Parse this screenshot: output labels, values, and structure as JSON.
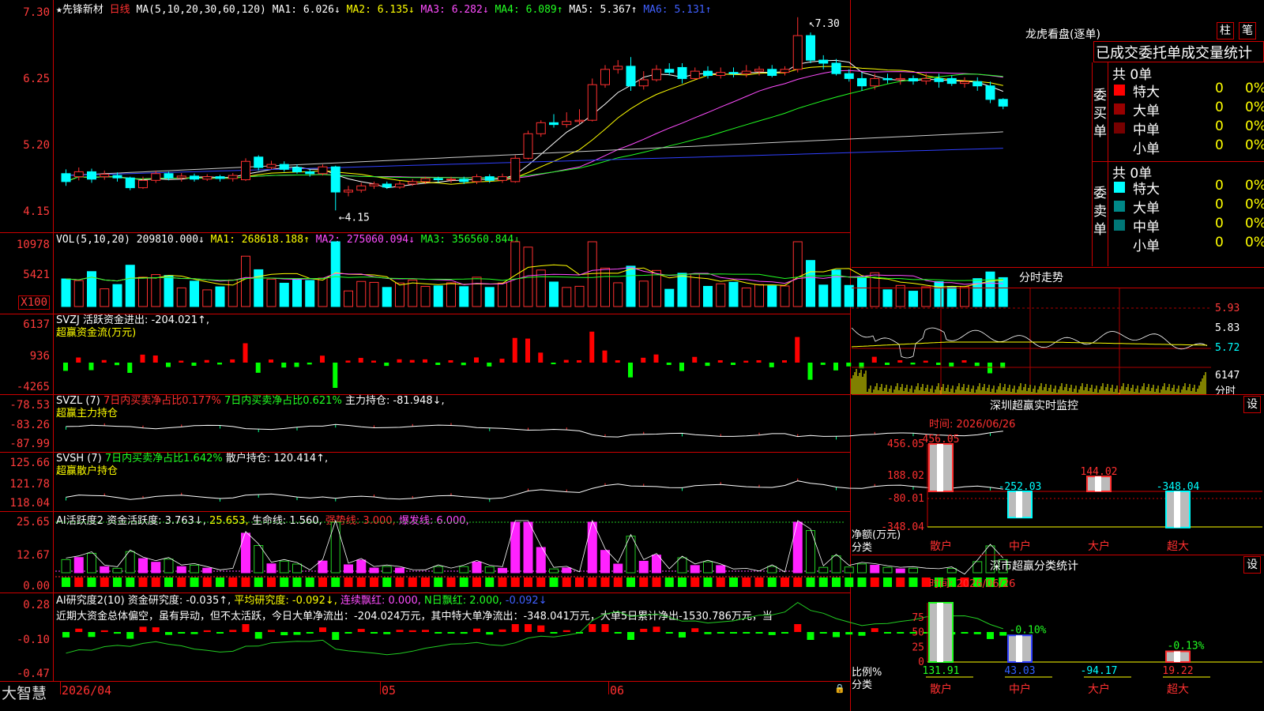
{
  "header": {
    "star": "★",
    "stock_name": "先锋新材",
    "period": "日线",
    "ma_params": "MA(5,10,20,30,60,120)",
    "ma_values": [
      {
        "label": "MA1:",
        "value": "6.026↓",
        "color": "#ffffff"
      },
      {
        "label": "MA2:",
        "value": "6.135↓",
        "color": "#ffff00"
      },
      {
        "label": "MA3:",
        "value": "6.282↓",
        "color": "#ff4dff"
      },
      {
        "label": "MA4:",
        "value": "6.089↑",
        "color": "#22ff22"
      },
      {
        "label": "MA5:",
        "value": "5.367↑",
        "color": "#ffffff"
      },
      {
        "label": "MA6:",
        "value": "5.131↑",
        "color": "#4060ff"
      }
    ]
  },
  "price_axis": [
    "7.30",
    "6.25",
    "5.20",
    "4.15"
  ],
  "price_annotations": {
    "high": "7.30",
    "low": "4.15"
  },
  "vol": {
    "axis": [
      "10978",
      "5421",
      "X100"
    ],
    "header": {
      "name": "VOL(5,10,20)",
      "value": "209810.000↓",
      "ma1": "MA1: 268618.188↑",
      "ma2": "MA2: 275060.094↓",
      "ma3": "MA3: 356560.844↓"
    }
  },
  "svzj": {
    "axis": [
      "6137",
      "936",
      "-4265"
    ],
    "line1": "SVZJ  活跃资金进出: -204.021↑,",
    "line2": "超赢资金流(万元)"
  },
  "svzl": {
    "axis": [
      "-78.53",
      "-83.26",
      "-87.99"
    ],
    "name": "SVZL (7)",
    "item1": "7日内买卖净占比0.177%",
    "item2": "7日内买卖净占比0.621%",
    "item3": "主力持仓: -81.948↓,",
    "line2": "超赢主力持仓"
  },
  "svsh": {
    "axis": [
      "125.66",
      "121.78",
      "118.04"
    ],
    "name": "SVSH (7)",
    "item1": "7日内买卖净占比1.642%",
    "item2": "散户持仓: 120.414↑,",
    "line2": "超赢散户持仓"
  },
  "ai1": {
    "axis": [
      "25.65",
      "12.67",
      "0.00"
    ],
    "name": "AI活跃度2",
    "item1": "资金活跃度: 3.763↓,",
    "item2": "25.653,",
    "item3": "生命线: 1.560,",
    "item4": "强势线: 3.000,",
    "item5": "爆发线: 6.000,"
  },
  "ai2": {
    "axis": [
      "0.28",
      "-0.10",
      "-0.47"
    ],
    "name": "AI研究度2(10)",
    "item1": "资金研究度: -0.035↑,",
    "item2": "平均研究度: -0.092↓,",
    "item3": "连续飘红: 0.000,",
    "item4": "N日飘红: 2.000,",
    "item5": "-0.092↓",
    "comment": "近期大资金总体偏空，虽有异动，但不太活跃，今日大单净流出：-204.024万元，其中特大单净流出：-348.041万元，大单5日累计净出-1530.786万元，当"
  },
  "footer": {
    "brand": "大智慧",
    "dates": [
      "2026/04",
      "05",
      "06"
    ]
  },
  "dragon": {
    "title": "龙虎看盘(逐单)",
    "btn1": "柱",
    "btn2": "笔",
    "tabs": "已成交委托单成交量统计",
    "buy_label": "委买单",
    "sell_label": "委卖单",
    "buy_total": "共 0单",
    "sell_total": "共 0单",
    "buy_rows": [
      {
        "name": "特大",
        "count": "0",
        "pct": "0%",
        "color": "#ff0000"
      },
      {
        "name": "大单",
        "count": "0",
        "pct": "0%",
        "color": "#990000"
      },
      {
        "name": "中单",
        "count": "0",
        "pct": "0%",
        "color": "#770000"
      },
      {
        "name": "小单",
        "count": "0",
        "pct": "0%",
        "color": "#000000"
      }
    ],
    "sell_rows": [
      {
        "name": "特大",
        "count": "0",
        "pct": "0%",
        "color": "#00ffff"
      },
      {
        "name": "大单",
        "count": "0",
        "pct": "0%",
        "color": "#008888"
      },
      {
        "name": "中单",
        "count": "0",
        "pct": "0%",
        "color": "#007777"
      },
      {
        "name": "小单",
        "count": "0",
        "pct": "0%",
        "color": "#000000"
      }
    ]
  },
  "intraday": {
    "title": "分时走势",
    "axis": [
      "5.93",
      "5.83",
      "5.72"
    ],
    "vol_axis": [
      "6147",
      "分时"
    ]
  },
  "sz_monitor": {
    "title": "深圳超赢实时监控",
    "btn": "设",
    "time": "时间: 2026/06/26",
    "axis": [
      "456.05",
      "188.02",
      "-80.01",
      "-348.04"
    ],
    "ylabel1": "净额(万元)",
    "ylabel2": "分类",
    "categories": [
      "散户",
      "中户",
      "大户",
      "超大"
    ],
    "values": [
      456.05,
      -252.03,
      144.02,
      -348.04
    ],
    "value_labels": [
      "456.05",
      "-252.03",
      "144.02",
      "-348.04"
    ]
  },
  "sz_class": {
    "title": "深市超赢分类统计",
    "btn": "设",
    "time": "时间: 2026/06/26",
    "axis": [
      "75",
      "50",
      "25",
      "0"
    ],
    "ylabel1": "比例%",
    "ylabel2": "分类",
    "categories": [
      "散户",
      "中户",
      "大户",
      "超大"
    ],
    "pct_labels": [
      "",
      "-0.10%",
      "",
      "-0.13%"
    ],
    "bottom_values": [
      "131.91",
      "43.03",
      "-94.17",
      "19.22"
    ],
    "heights_pct": [
      100,
      45,
      0,
      18
    ]
  },
  "chart_data": {
    "type": "candlestick",
    "title": "先锋新材 日线",
    "ylim": [
      4.15,
      7.3
    ],
    "x_labels": [
      "2026/04",
      "05",
      "06"
    ],
    "candles": [
      {
        "o": 4.75,
        "c": 4.62,
        "h": 4.82,
        "l": 4.55
      },
      {
        "o": 4.7,
        "c": 4.78,
        "h": 4.85,
        "l": 4.64
      },
      {
        "o": 4.78,
        "c": 4.66,
        "h": 4.83,
        "l": 4.6
      },
      {
        "o": 4.7,
        "c": 4.74,
        "h": 4.8,
        "l": 4.65
      },
      {
        "o": 4.72,
        "c": 4.68,
        "h": 4.77,
        "l": 4.62
      },
      {
        "o": 4.68,
        "c": 4.52,
        "h": 4.7,
        "l": 4.48
      },
      {
        "o": 4.52,
        "c": 4.64,
        "h": 4.7,
        "l": 4.5
      },
      {
        "o": 4.64,
        "c": 4.75,
        "h": 4.8,
        "l": 4.6
      },
      {
        "o": 4.75,
        "c": 4.68,
        "h": 4.78,
        "l": 4.64
      },
      {
        "o": 4.68,
        "c": 4.71,
        "h": 4.76,
        "l": 4.62
      },
      {
        "o": 4.71,
        "c": 4.66,
        "h": 4.75,
        "l": 4.62
      },
      {
        "o": 4.66,
        "c": 4.7,
        "h": 4.74,
        "l": 4.63
      },
      {
        "o": 4.7,
        "c": 4.67,
        "h": 4.73,
        "l": 4.62
      },
      {
        "o": 4.67,
        "c": 4.72,
        "h": 4.76,
        "l": 4.62
      },
      {
        "o": 4.65,
        "c": 4.95,
        "h": 5.0,
        "l": 4.63
      },
      {
        "o": 5.02,
        "c": 4.85,
        "h": 5.05,
        "l": 4.8
      },
      {
        "o": 4.85,
        "c": 4.9,
        "h": 4.96,
        "l": 4.82
      },
      {
        "o": 4.9,
        "c": 4.82,
        "h": 4.95,
        "l": 4.78
      },
      {
        "o": 4.85,
        "c": 4.78,
        "h": 4.9,
        "l": 4.75
      },
      {
        "o": 4.78,
        "c": 4.75,
        "h": 4.82,
        "l": 4.7
      },
      {
        "o": 4.75,
        "c": 4.86,
        "h": 4.9,
        "l": 4.72
      },
      {
        "o": 4.86,
        "c": 4.45,
        "h": 4.88,
        "l": 4.15
      },
      {
        "o": 4.45,
        "c": 4.48,
        "h": 4.55,
        "l": 4.38
      },
      {
        "o": 4.48,
        "c": 4.55,
        "h": 4.6,
        "l": 4.44
      },
      {
        "o": 4.55,
        "c": 4.58,
        "h": 4.62,
        "l": 4.5
      },
      {
        "o": 4.58,
        "c": 4.53,
        "h": 4.62,
        "l": 4.5
      },
      {
        "o": 4.53,
        "c": 4.58,
        "h": 4.63,
        "l": 4.5
      },
      {
        "o": 4.58,
        "c": 4.62,
        "h": 4.66,
        "l": 4.55
      },
      {
        "o": 4.62,
        "c": 4.67,
        "h": 4.7,
        "l": 4.58
      },
      {
        "o": 4.67,
        "c": 4.65,
        "h": 4.7,
        "l": 4.6
      },
      {
        "o": 4.65,
        "c": 4.66,
        "h": 4.7,
        "l": 4.6
      },
      {
        "o": 4.66,
        "c": 4.62,
        "h": 4.7,
        "l": 4.58
      },
      {
        "o": 4.62,
        "c": 4.7,
        "h": 4.74,
        "l": 4.58
      },
      {
        "o": 4.7,
        "c": 4.64,
        "h": 4.74,
        "l": 4.6
      },
      {
        "o": 4.64,
        "c": 4.7,
        "h": 4.75,
        "l": 4.6
      },
      {
        "o": 4.62,
        "c": 5.0,
        "h": 5.05,
        "l": 4.6
      },
      {
        "o": 5.0,
        "c": 5.4,
        "h": 5.45,
        "l": 4.98
      },
      {
        "o": 5.4,
        "c": 5.58,
        "h": 5.62,
        "l": 5.35
      },
      {
        "o": 5.58,
        "c": 5.55,
        "h": 5.72,
        "l": 5.5
      },
      {
        "o": 5.55,
        "c": 5.6,
        "h": 5.75,
        "l": 5.5
      },
      {
        "o": 5.6,
        "c": 5.62,
        "h": 5.8,
        "l": 5.55
      },
      {
        "o": 5.62,
        "c": 6.2,
        "h": 6.3,
        "l": 5.6
      },
      {
        "o": 6.2,
        "c": 6.45,
        "h": 6.52,
        "l": 6.15
      },
      {
        "o": 6.45,
        "c": 6.5,
        "h": 6.6,
        "l": 6.38
      },
      {
        "o": 6.5,
        "c": 6.18,
        "h": 6.65,
        "l": 6.1
      },
      {
        "o": 6.18,
        "c": 6.28,
        "h": 6.42,
        "l": 6.12
      },
      {
        "o": 6.28,
        "c": 6.45,
        "h": 6.52,
        "l": 6.25
      },
      {
        "o": 6.45,
        "c": 6.4,
        "h": 6.55,
        "l": 6.35
      },
      {
        "o": 6.48,
        "c": 6.3,
        "h": 6.55,
        "l": 6.22
      },
      {
        "o": 6.3,
        "c": 6.42,
        "h": 6.48,
        "l": 6.28
      },
      {
        "o": 6.42,
        "c": 6.35,
        "h": 6.5,
        "l": 6.3
      },
      {
        "o": 6.35,
        "c": 6.4,
        "h": 6.48,
        "l": 6.3
      },
      {
        "o": 6.4,
        "c": 6.38,
        "h": 6.48,
        "l": 6.32
      },
      {
        "o": 6.38,
        "c": 6.42,
        "h": 6.52,
        "l": 6.32
      },
      {
        "o": 6.42,
        "c": 6.45,
        "h": 6.5,
        "l": 6.35
      },
      {
        "o": 6.45,
        "c": 6.35,
        "h": 6.52,
        "l": 6.32
      },
      {
        "o": 6.4,
        "c": 6.45,
        "h": 6.5,
        "l": 6.35
      },
      {
        "o": 6.45,
        "c": 7.0,
        "h": 7.3,
        "l": 6.4
      },
      {
        "o": 7.0,
        "c": 6.6,
        "h": 7.05,
        "l": 6.55
      },
      {
        "o": 6.6,
        "c": 6.55,
        "h": 6.68,
        "l": 6.45
      },
      {
        "o": 6.55,
        "c": 6.38,
        "h": 6.62,
        "l": 6.35
      },
      {
        "o": 6.38,
        "c": 6.3,
        "h": 6.45,
        "l": 6.25
      },
      {
        "o": 6.3,
        "c": 6.18,
        "h": 6.4,
        "l": 6.1
      },
      {
        "o": 6.18,
        "c": 6.3,
        "h": 6.38,
        "l": 6.12
      },
      {
        "o": 6.3,
        "c": 6.28,
        "h": 6.38,
        "l": 6.22
      },
      {
        "o": 6.28,
        "c": 6.3,
        "h": 6.38,
        "l": 6.2
      },
      {
        "o": 6.3,
        "c": 6.26,
        "h": 6.35,
        "l": 6.2
      },
      {
        "o": 6.26,
        "c": 6.3,
        "h": 6.38,
        "l": 6.2
      },
      {
        "o": 6.3,
        "c": 6.25,
        "h": 6.38,
        "l": 6.15
      },
      {
        "o": 6.3,
        "c": 6.22,
        "h": 6.35,
        "l": 6.18
      },
      {
        "o": 6.22,
        "c": 6.25,
        "h": 6.32,
        "l": 6.15
      },
      {
        "o": 6.25,
        "c": 6.18,
        "h": 6.32,
        "l": 6.1
      },
      {
        "o": 6.18,
        "c": 5.96,
        "h": 6.25,
        "l": 5.9
      },
      {
        "o": 5.96,
        "c": 5.85,
        "h": 5.98,
        "l": 5.8
      }
    ]
  }
}
